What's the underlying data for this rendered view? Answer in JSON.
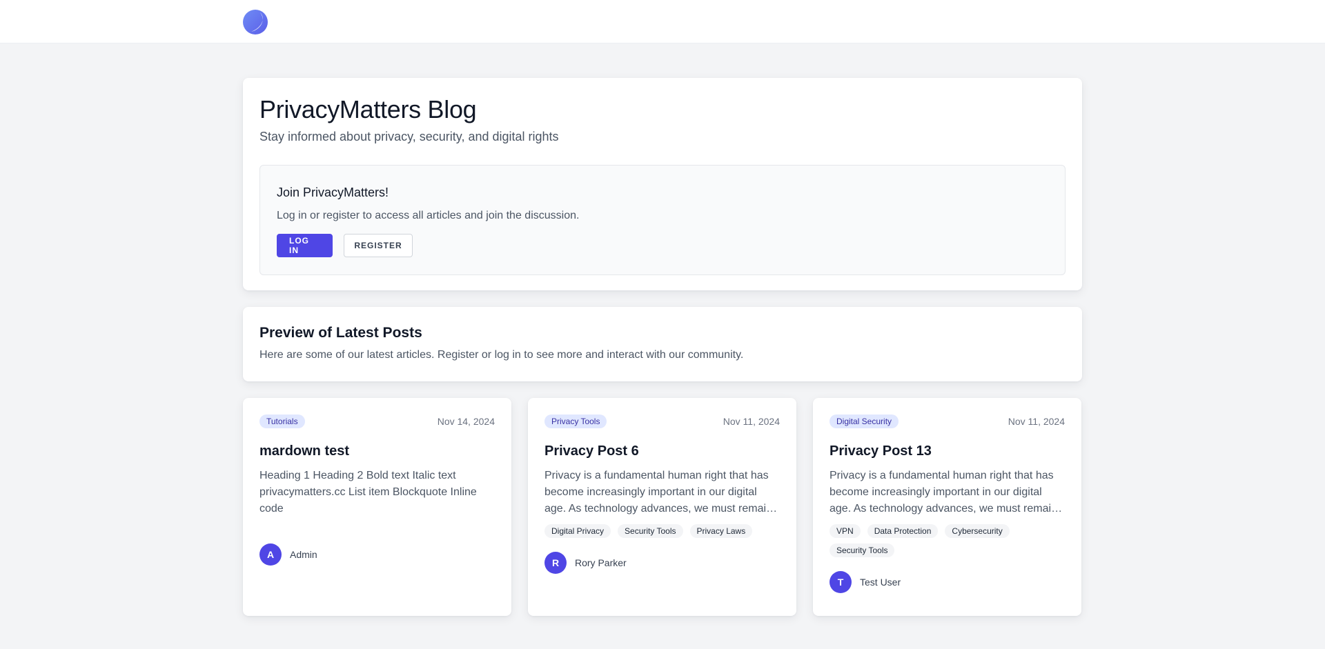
{
  "brand": {
    "logo_icon": "moon-logo-icon",
    "accent_color": "#4f46e5"
  },
  "hero": {
    "title": "PrivacyMatters Blog",
    "subtitle": "Stay informed about privacy, security, and digital rights",
    "join": {
      "title": "Join PrivacyMatters!",
      "text": "Log in or register to access all articles and join the discussion.",
      "login_label": "LOG IN",
      "register_label": "REGISTER"
    }
  },
  "preview": {
    "title": "Preview of Latest Posts",
    "text": "Here are some of our latest articles. Register or log in to see more and interact with our community."
  },
  "posts": [
    {
      "category": "Tutorials",
      "date": "Nov 14, 2024",
      "title": "mardown test",
      "excerpt": "Heading 1 Heading 2 Bold text Italic text privacymatters.cc List item Blockquote Inline code",
      "tags": [],
      "author_initial": "A",
      "author": "Admin"
    },
    {
      "category": "Privacy Tools",
      "date": "Nov 11, 2024",
      "title": "Privacy Post 6",
      "excerpt": "Privacy is a fundamental human right that has become increasingly important in our digital age. As technology advances, we must remain vigilant about protecting our personal information.",
      "tags": [
        "Digital Privacy",
        "Security Tools",
        "Privacy Laws"
      ],
      "author_initial": "R",
      "author": "Rory Parker"
    },
    {
      "category": "Digital Security",
      "date": "Nov 11, 2024",
      "title": "Privacy Post 13",
      "excerpt": "Privacy is a fundamental human right that has become increasingly important in our digital age. As technology advances, we must remain vigilant about protecting our personal information.",
      "tags": [
        "VPN",
        "Data Protection",
        "Cybersecurity",
        "Security Tools"
      ],
      "author_initial": "T",
      "author": "Test User"
    }
  ]
}
